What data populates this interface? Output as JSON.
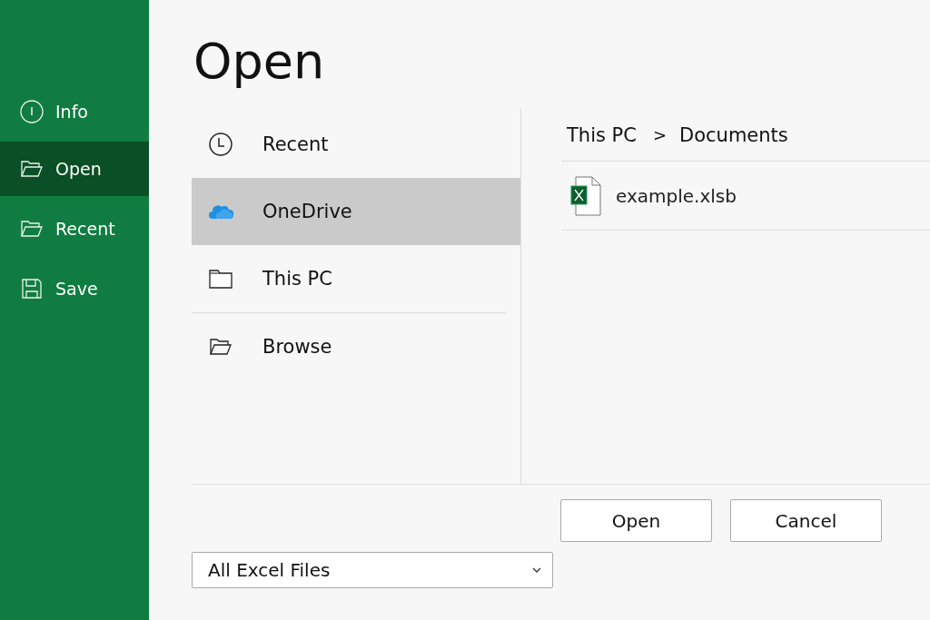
{
  "sidebar": {
    "items": [
      {
        "label": "Info",
        "kind": "info",
        "selected": false
      },
      {
        "label": "Open",
        "kind": "openfolder",
        "selected": true
      },
      {
        "label": "Recent",
        "kind": "openfolder",
        "selected": false
      },
      {
        "label": "Save",
        "kind": "save",
        "selected": false
      }
    ]
  },
  "title": "Open",
  "location_groups": [
    {
      "items": [
        {
          "label": "Recent",
          "kind": "clock",
          "selected": false
        },
        {
          "label": "OneDrive",
          "kind": "cloud",
          "selected": true
        },
        {
          "label": "This PC",
          "kind": "folder",
          "selected": false
        }
      ]
    },
    {
      "items": [
        {
          "label": "Browse",
          "kind": "openfolder",
          "selected": false
        }
      ]
    }
  ],
  "breadcrumb": [
    "This PC",
    "Documents"
  ],
  "breadcrumb_separator": ">",
  "files": [
    {
      "name": "example.xlsb",
      "kind": "excel"
    }
  ],
  "buttons": [
    "Open",
    "Cancel"
  ],
  "file_type": {
    "value": "All Excel Files"
  }
}
